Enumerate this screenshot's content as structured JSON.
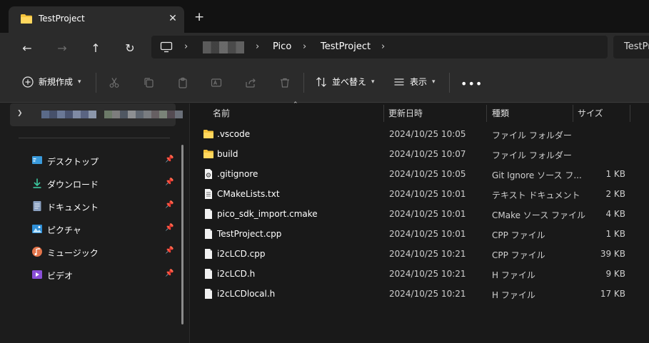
{
  "window": {
    "tab_title": "TestProject",
    "close_glyph": "✕",
    "new_tab_glyph": "+"
  },
  "nav": {
    "back_glyph": "←",
    "forward_glyph": "→",
    "up_glyph": "↑",
    "refresh_glyph": "↻",
    "breadcrumb": [
      "Pico",
      "TestProject"
    ],
    "breadcrumb_sep": "›",
    "search_text": "TestPr"
  },
  "toolbar": {
    "new_label": "新規作成",
    "sort_label": "並べ替え",
    "view_label": "表示",
    "more_glyph": "•••"
  },
  "sidebar": {
    "items": [
      {
        "label": "デスクトップ",
        "icon": "desktop-icon"
      },
      {
        "label": "ダウンロード",
        "icon": "download-icon"
      },
      {
        "label": "ドキュメント",
        "icon": "document-icon"
      },
      {
        "label": "ピクチャ",
        "icon": "pictures-icon"
      },
      {
        "label": "ミュージック",
        "icon": "music-icon"
      },
      {
        "label": "ビデオ",
        "icon": "video-icon"
      }
    ]
  },
  "columns": {
    "name": "名前",
    "modified": "更新日時",
    "type": "種類",
    "size": "サイズ"
  },
  "files": [
    {
      "name": ".vscode",
      "modified": "2024/10/25 10:05",
      "type": "ファイル フォルダー",
      "size": "",
      "icon": "folder-icon"
    },
    {
      "name": "build",
      "modified": "2024/10/25 10:07",
      "type": "ファイル フォルダー",
      "size": "",
      "icon": "folder-icon"
    },
    {
      "name": ".gitignore",
      "modified": "2024/10/25 10:05",
      "type": "Git Ignore ソース フ...",
      "size": "1 KB",
      "icon": "gear-file-icon"
    },
    {
      "name": "CMakeLists.txt",
      "modified": "2024/10/25 10:01",
      "type": "テキスト ドキュメント",
      "size": "2 KB",
      "icon": "text-file-icon"
    },
    {
      "name": "pico_sdk_import.cmake",
      "modified": "2024/10/25 10:01",
      "type": "CMake ソース ファイル",
      "size": "4 KB",
      "icon": "file-icon"
    },
    {
      "name": "TestProject.cpp",
      "modified": "2024/10/25 10:01",
      "type": "CPP ファイル",
      "size": "1 KB",
      "icon": "file-icon"
    },
    {
      "name": "i2cLCD.cpp",
      "modified": "2024/10/25 10:21",
      "type": "CPP ファイル",
      "size": "39 KB",
      "icon": "file-icon"
    },
    {
      "name": "i2cLCD.h",
      "modified": "2024/10/25 10:21",
      "type": "H ファイル",
      "size": "9 KB",
      "icon": "file-icon"
    },
    {
      "name": "i2cLCDlocal.h",
      "modified": "2024/10/25 10:21",
      "type": "H ファイル",
      "size": "17 KB",
      "icon": "file-icon"
    }
  ],
  "colors": {
    "folder": "#f4c33c",
    "accent": "#4cc2ff"
  }
}
